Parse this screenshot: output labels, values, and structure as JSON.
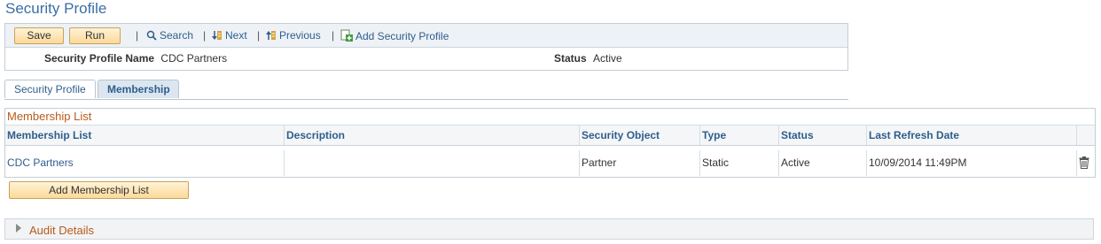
{
  "page_title": "Security Profile",
  "toolbar": {
    "save_label": "Save",
    "run_label": "Run",
    "search_label": "Search",
    "next_label": "Next",
    "previous_label": "Previous",
    "add_profile_label": "Add Security Profile",
    "separator": "|"
  },
  "header": {
    "profile_name_label": "Security Profile Name",
    "profile_name_value": "CDC Partners",
    "status_label": "Status",
    "status_value": "Active"
  },
  "tabs": [
    {
      "label": "Security Profile",
      "active": false
    },
    {
      "label": "Membership",
      "active": true
    }
  ],
  "grid": {
    "title": "Membership List",
    "columns": [
      "Membership List",
      "Description",
      "Security Object",
      "Type",
      "Status",
      "Last Refresh Date"
    ],
    "rows": [
      {
        "membership_list": "CDC Partners",
        "description": "",
        "security_object": "Partner",
        "type": "Static",
        "status": "Active",
        "last_refresh": "10/09/2014 11:49PM"
      }
    ]
  },
  "add_membership_label": "Add Membership List",
  "audit_label": "Audit Details",
  "colors": {
    "title_blue": "#3a6ea5",
    "link_blue": "#2f5e8c",
    "section_orange": "#b85a1a",
    "button_fill": "#fbd99a"
  }
}
